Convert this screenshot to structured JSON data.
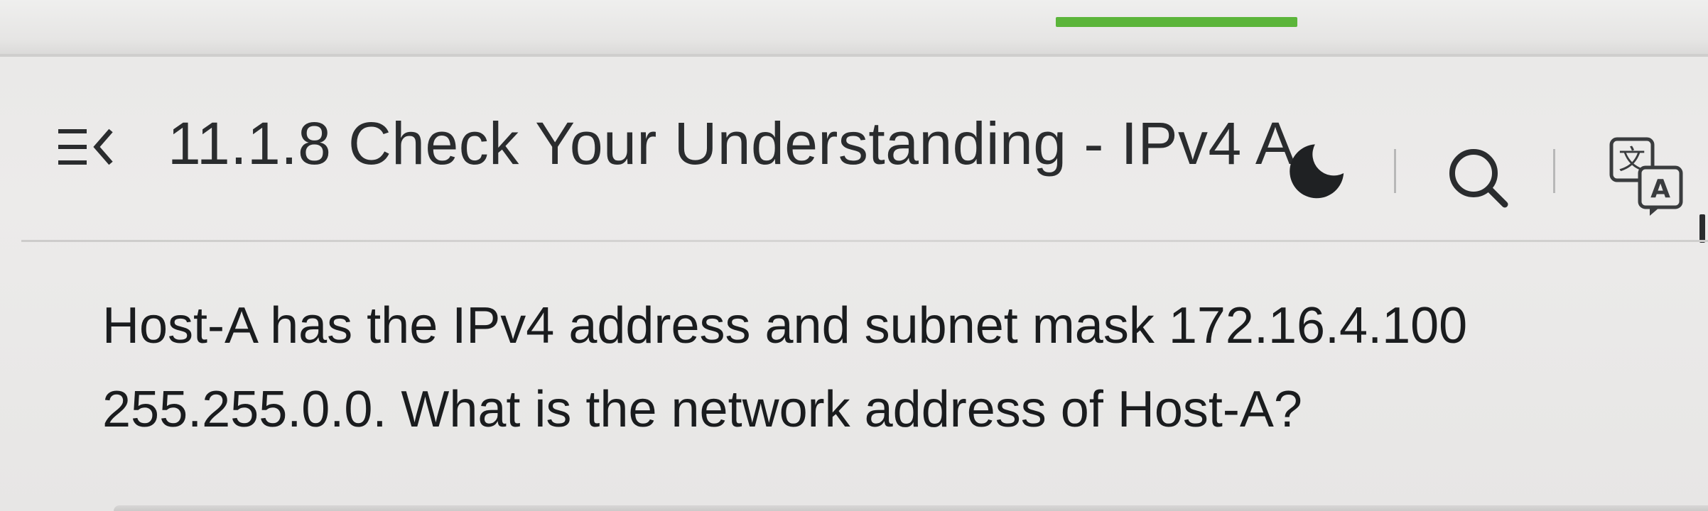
{
  "header": {
    "menu_icon": "menu-collapse-icon",
    "title": "11.1.8 Check Your Understanding - IPv4 A",
    "theme_icon": "moon-icon",
    "search_icon": "search-icon",
    "language_icon": "translate-icon",
    "language_glyph_cjk": "文",
    "language_glyph_latin": "A"
  },
  "progress": {
    "color": "#5bb53a"
  },
  "question": {
    "line1": "Host-A has the IPv4 address and subnet mask 172.16.4.100",
    "line2": "255.255.0.0. What is the network address of Host-A?"
  },
  "colors": {
    "text": "#1d1f21",
    "background": "#ecebea",
    "accent": "#5bb53a"
  }
}
